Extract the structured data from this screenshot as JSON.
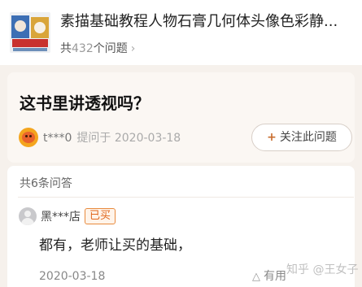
{
  "product": {
    "title": "素描基础教程人物石膏几何体头像色彩静...",
    "count_prefix": "共",
    "count_value": "432",
    "count_suffix": "个问题"
  },
  "question": {
    "text": "这书里讲透视吗？",
    "asker": "t***0",
    "asked_on": "提问于 2020-03-18",
    "follow_label": "关注此问题"
  },
  "answers": {
    "count_label": "共6条问答",
    "items": [
      {
        "user": "黑***店",
        "badge": "已买",
        "text": "都有，老师让买的基础，",
        "date": "2020-03-18",
        "helpful_label": "有用"
      }
    ]
  },
  "watermark": "知乎 @王女子",
  "colors": {
    "accent": "#e0661c",
    "background": "#f6f1ec"
  },
  "icons": {
    "chevron": "chevron-right-icon",
    "follow": "plus-icon",
    "helpful": "thumbs-up-icon"
  }
}
